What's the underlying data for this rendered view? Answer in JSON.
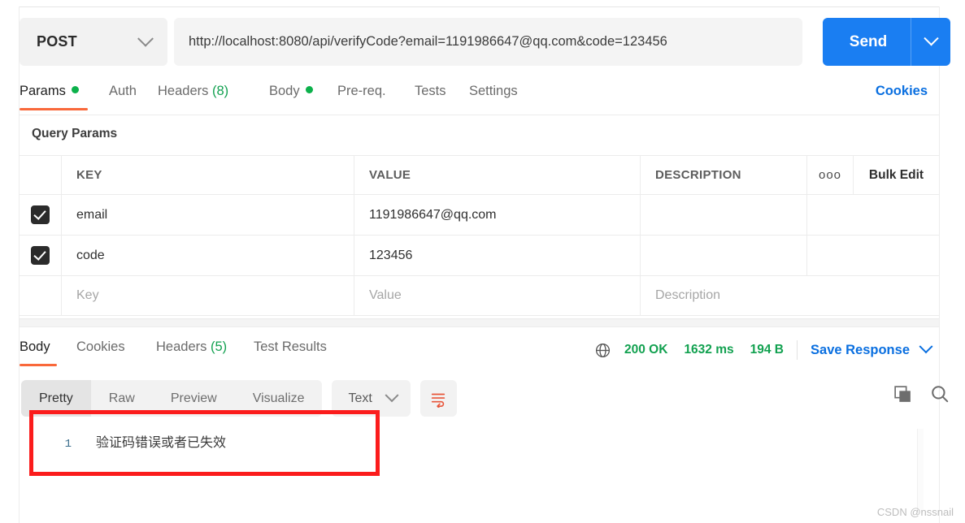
{
  "request": {
    "method": "POST",
    "url": "http://localhost:8080/api/verifyCode?email=1191986647@qq.com&code=123456",
    "send_label": "Send",
    "cookies_link": "Cookies",
    "tabs": [
      {
        "label": "Params",
        "marker": "dot",
        "active": true
      },
      {
        "label": "Auth",
        "marker": "",
        "active": false
      },
      {
        "label": "Headers",
        "count": "(8)",
        "marker": "count",
        "active": false
      },
      {
        "label": "Body",
        "marker": "dot",
        "active": false
      },
      {
        "label": "Pre-req.",
        "marker": "",
        "active": false
      },
      {
        "label": "Tests",
        "marker": "",
        "active": false
      },
      {
        "label": "Settings",
        "marker": "",
        "active": false
      }
    ]
  },
  "query_params": {
    "section_title": "Query Params",
    "columns": {
      "key": "KEY",
      "value": "VALUE",
      "description": "DESCRIPTION",
      "more": "ooo",
      "bulk_edit": "Bulk Edit"
    },
    "rows": [
      {
        "checked": true,
        "key": "email",
        "value": "1191986647@qq.com",
        "description": ""
      },
      {
        "checked": true,
        "key": "code",
        "value": "123456",
        "description": ""
      }
    ],
    "empty_row": {
      "key_placeholder": "Key",
      "value_placeholder": "Value",
      "description_placeholder": "Description"
    }
  },
  "response": {
    "tabs": [
      {
        "label": "Body",
        "active": true
      },
      {
        "label": "Cookies",
        "active": false
      },
      {
        "label": "Headers",
        "count": "(5)",
        "active": false
      },
      {
        "label": "Test Results",
        "active": false
      }
    ],
    "status": {
      "code": "200 OK",
      "time": "1632 ms",
      "size": "194 B",
      "save_label": "Save Response"
    },
    "view_modes": [
      {
        "label": "Pretty",
        "active": true
      },
      {
        "label": "Raw",
        "active": false
      },
      {
        "label": "Preview",
        "active": false
      },
      {
        "label": "Visualize",
        "active": false
      }
    ],
    "format": "Text",
    "body_lines": [
      {
        "no": "1",
        "text": "验证码错误或者已失效"
      }
    ]
  },
  "colors": {
    "accent_orange": "#f9683a",
    "send_blue": "#1a7ef2",
    "link_blue": "#0a6fe0",
    "status_green": "#12a150",
    "highlight_red": "#fb1c1c",
    "wrap_icon": "#e8553a"
  },
  "watermark": "CSDN @nssnail"
}
